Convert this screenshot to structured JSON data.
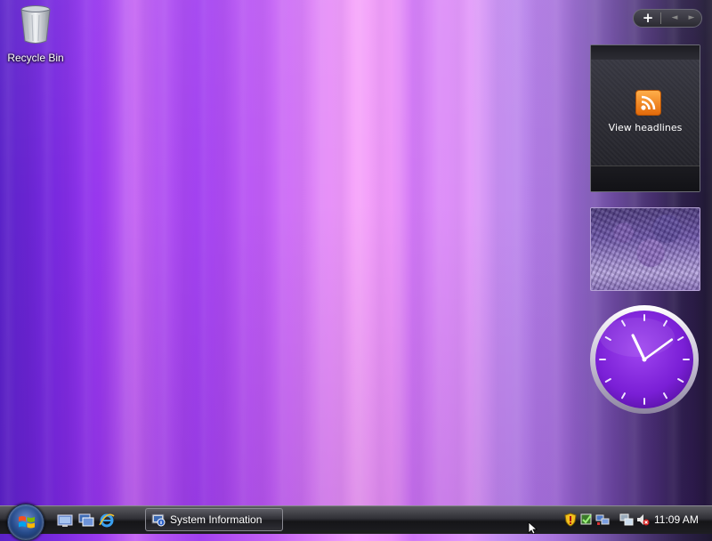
{
  "desktop": {
    "icons": [
      {
        "label": "Recycle Bin",
        "icon": "recycle-bin-icon"
      }
    ]
  },
  "sidebar": {
    "controls": {
      "add": "+",
      "prev": "◄",
      "next": "►"
    },
    "feed_gadget": {
      "label": "View headlines",
      "icon": "rss-icon"
    },
    "slideshow_gadget": {
      "icon": "photo"
    },
    "clock_gadget": {
      "hour": 11,
      "minute": 9
    }
  },
  "taskbar": {
    "start_button": {
      "icon": "windows-flag-icon"
    },
    "quick_launch": [
      {
        "name": "show-desktop-icon"
      },
      {
        "name": "switch-windows-icon"
      },
      {
        "name": "internet-explorer-icon"
      }
    ],
    "tasks": [
      {
        "label": "System Information",
        "icon": "system-information-icon"
      }
    ],
    "tray": {
      "icons": [
        "security-shield-icon",
        "windows-defender-icon",
        "network-update-icon",
        "network-icon",
        "volume-muted-icon"
      ],
      "time": "11:09 AM"
    }
  },
  "colors": {
    "wallpaper_accent": "#b455f2",
    "clock_face": "#8a2be2",
    "rss_orange": "#f28a1e"
  }
}
